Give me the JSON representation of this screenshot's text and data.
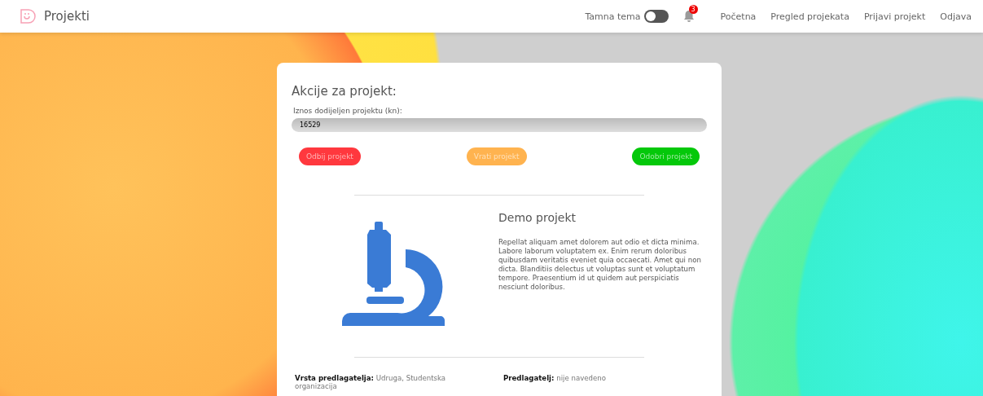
{
  "navbar": {
    "brand": "Projekti",
    "dark_theme": {
      "label": "Tamna tema",
      "on": false
    },
    "notifications": {
      "count": "3"
    },
    "links": [
      {
        "label": "Početna"
      },
      {
        "label": "Pregled projekata"
      },
      {
        "label": "Prijavi projekt"
      },
      {
        "label": "Odjava"
      }
    ]
  },
  "actions": {
    "title": "Akcije za projekt:",
    "amount_label": "Iznos dodijeljen projektu (kn):",
    "amount_value": "16529",
    "buttons": [
      {
        "label": "Odbij projekt",
        "kind": "reject"
      },
      {
        "label": "Vrati projekt",
        "kind": "return"
      },
      {
        "label": "Odobri projekt",
        "kind": "approve"
      }
    ]
  },
  "project": {
    "title": "Demo projekt",
    "description": "Repellat aliquam amet dolorem aut odio et dicta minima. Labore laborum voluptatem ex. Enim rerum doloribus quibusdam veritatis eveniet quia occaecati. Amet qui non dicta. Blanditiis delectus ut voluptas sunt et voluptatum tempore. Praesentium id ut quidem aut perspiciatis nesciunt doloribus."
  },
  "details": [
    "**Vrsta predlagatelja:** Udruga, Studentska organizacija",
    "**Predlagatelj:** nije navedeno"
  ]
}
